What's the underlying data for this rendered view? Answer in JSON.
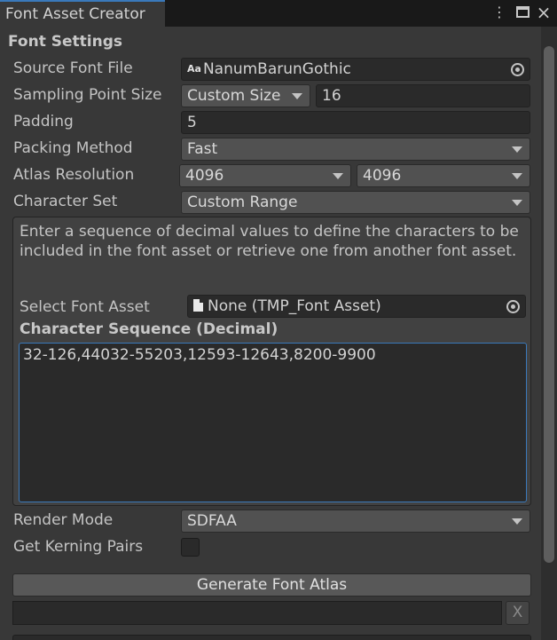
{
  "tab": {
    "title": "Font Asset Creator"
  },
  "window_controls": {
    "menu_icon": "kebab-menu-icon",
    "maximize_icon": "maximize-icon",
    "close_icon": "close-icon",
    "close_glyph": "×"
  },
  "section": {
    "title": "Font Settings"
  },
  "fields": {
    "source_font_file": {
      "label": "Source Font File",
      "icon_text": "Aa",
      "value": "NanumBarunGothic"
    },
    "sampling_point_size": {
      "label": "Sampling Point Size",
      "mode": "Custom Size",
      "value": "16"
    },
    "padding": {
      "label": "Padding",
      "value": "5"
    },
    "packing_method": {
      "label": "Packing Method",
      "value": "Fast"
    },
    "atlas_resolution": {
      "label": "Atlas Resolution",
      "width": "4096",
      "height": "4096"
    },
    "character_set": {
      "label": "Character Set",
      "value": "Custom Range"
    }
  },
  "help": {
    "text": "Enter a sequence of decimal values to define the characters to be included in the font asset or retrieve one from another font asset.",
    "select_font_asset_label": "Select Font Asset",
    "select_font_asset_value": "None (TMP_Font Asset)",
    "char_seq_title": "Character Sequence (Decimal)",
    "char_seq_value": "32-126,44032-55203,12593-12643,8200-9900"
  },
  "render_mode": {
    "label": "Render Mode",
    "value": "SDFAA"
  },
  "kerning": {
    "label": "Get Kerning Pairs",
    "checked": false
  },
  "generate_button": {
    "label": "Generate Font Atlas"
  },
  "progress": {
    "value": 0,
    "cancel_label": "X"
  }
}
